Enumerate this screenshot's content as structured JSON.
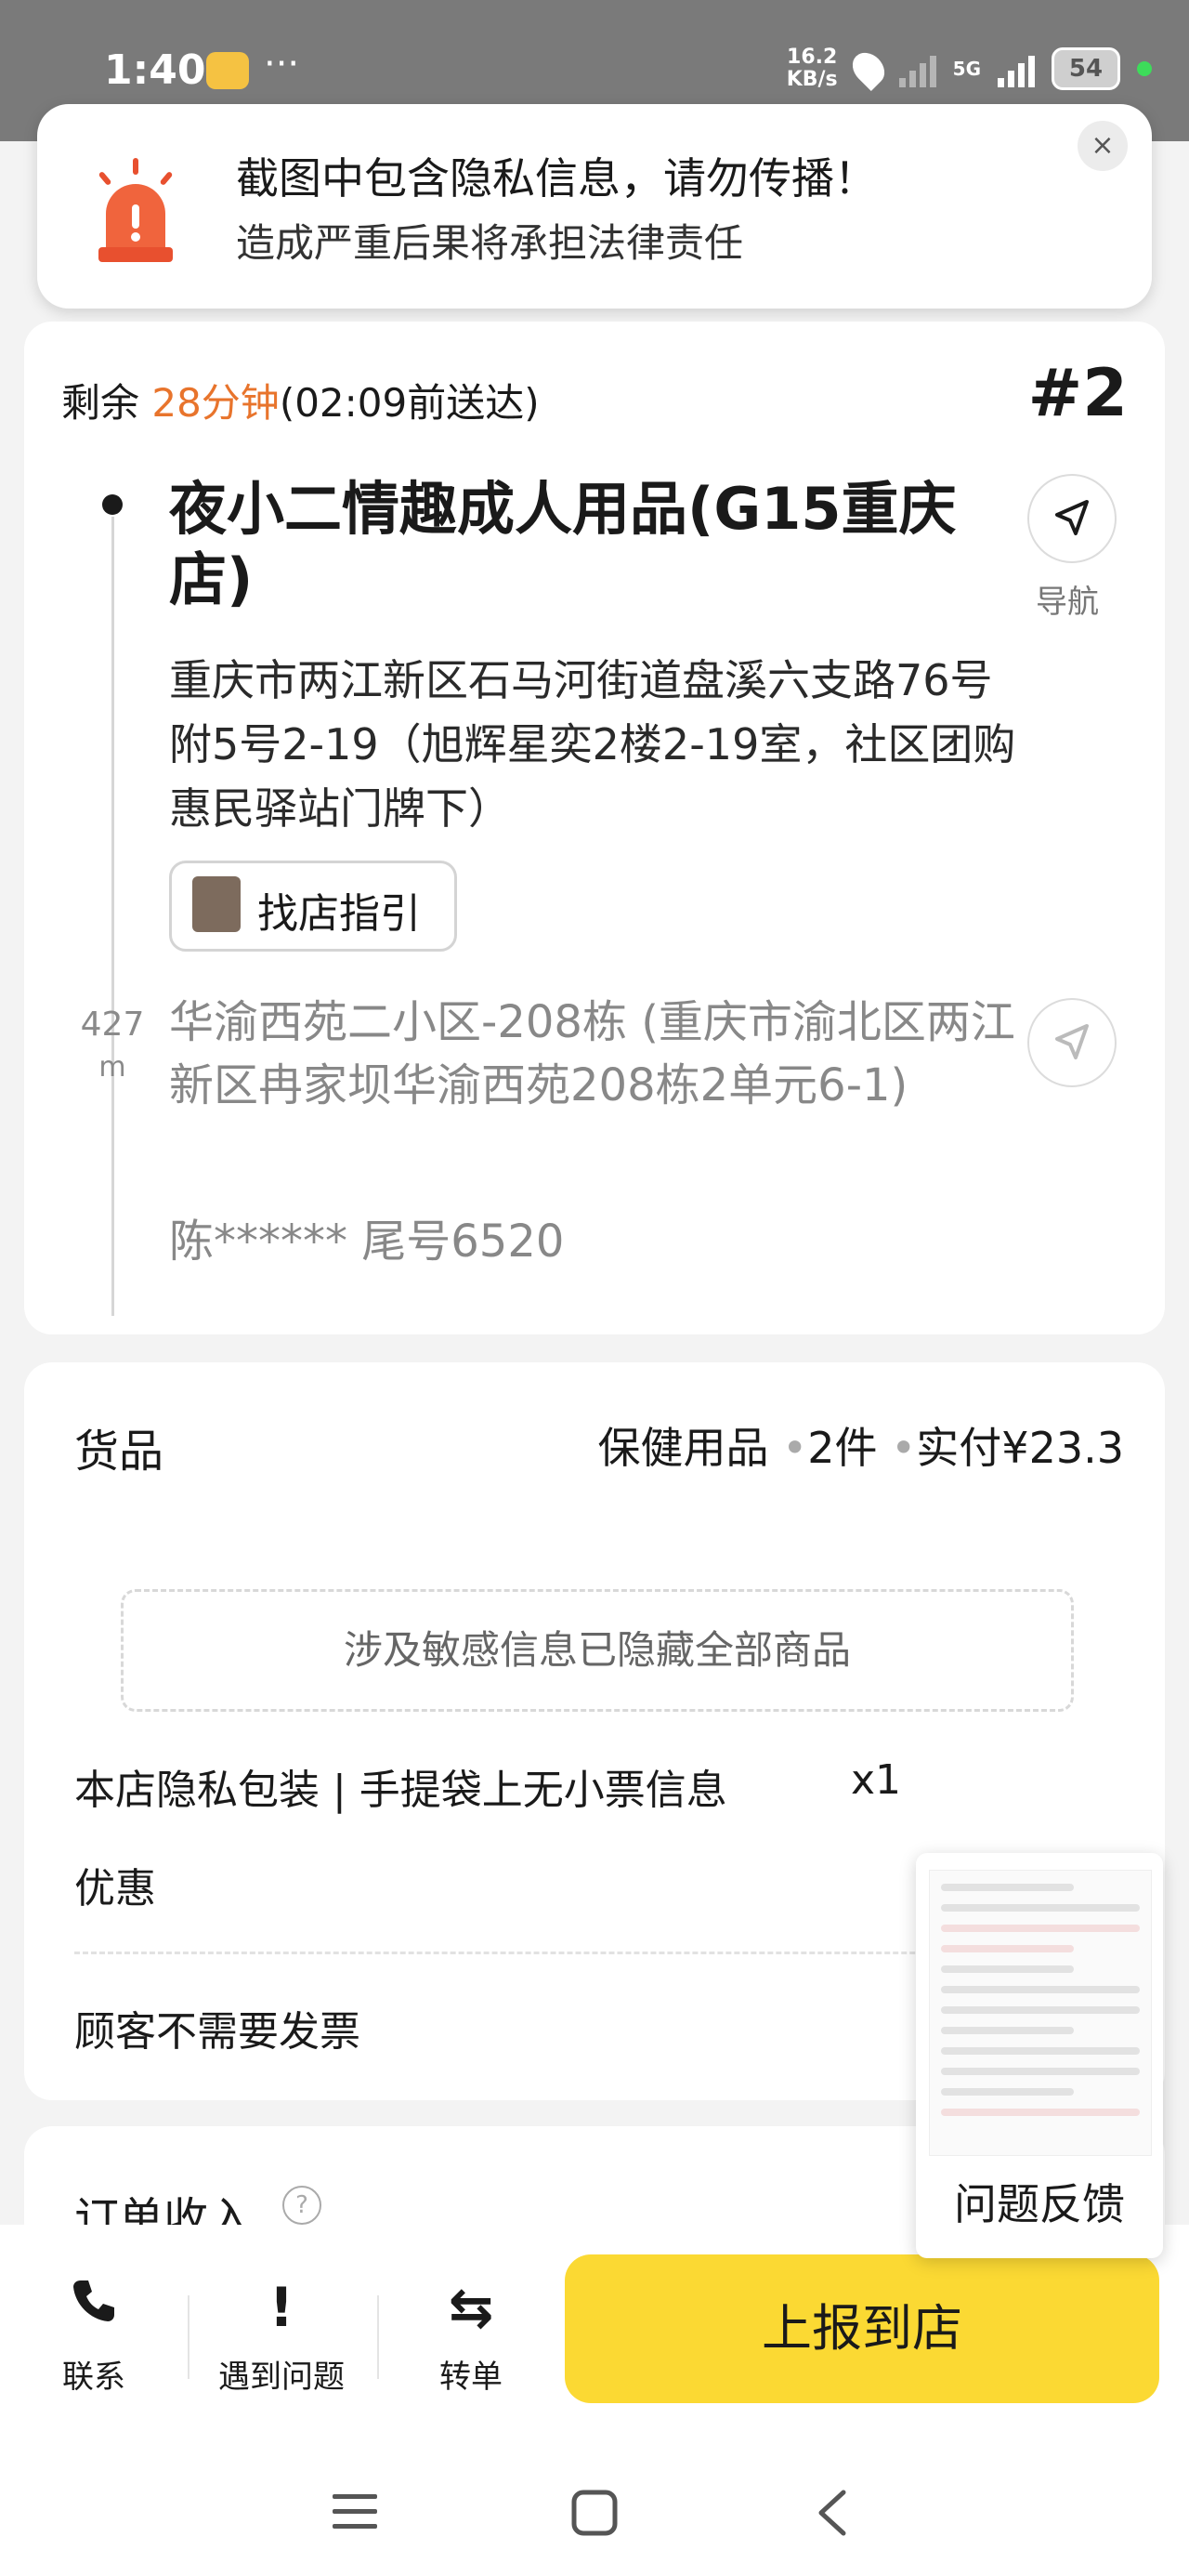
{
  "status_bar": {
    "time": "1:40",
    "dots": "···",
    "net_speed_value": "16.2",
    "net_speed_unit": "KB/s",
    "network": "5G",
    "battery": "54"
  },
  "privacy_notice": {
    "title": "截图中包含隐私信息，请勿传播！",
    "subtitle": "造成严重后果将承担法律责任",
    "close_icon": "×"
  },
  "delivery": {
    "remaining_prefix": "剩余 ",
    "remaining_time": "28分钟",
    "deadline": "(02:09前送达)",
    "order_number": "#2",
    "shop_name": "夜小二情趣成人用品(G15重庆店)",
    "shop_address": "重庆市两江新区石马河街道盘溪六支路76号附5号2-19（旭辉星奕2楼2-19室，社区团购惠民驿站门牌下）",
    "nav_label": "导航",
    "guide_button": "找店指引",
    "distance_value": "427",
    "distance_unit": "m",
    "customer_address": "华渝西苑二小区-208栋 (重庆市渝北区两江新区冉家坝华渝西苑208栋2单元6-1)",
    "customer_name": "陈****** 尾号6520"
  },
  "goods": {
    "title": "货品",
    "category": "保健用品",
    "count": "2件",
    "paid": "实付¥23.3",
    "hidden_notice": "涉及敏感信息已隐藏全部商品",
    "package_item": "本店隐私包装 | 手提袋上无小票信息",
    "package_qty": "x1",
    "discount_label": "优惠",
    "invoice_label": "顾客不需要发票"
  },
  "income": {
    "title": "订单收入",
    "help_icon": "?"
  },
  "bottom_bar": {
    "contact": "联系",
    "problem": "遇到问题",
    "transfer": "转单",
    "problem_icon": "!",
    "transfer_icon": "⇆",
    "report_button": "上报到店"
  },
  "feedback_widget": {
    "label": "问题反馈"
  },
  "icons": {
    "siren": "siren-icon",
    "navigate": "navigate-arrow-icon",
    "phone": "phone-icon"
  },
  "colors": {
    "accent_orange": "#e8742c",
    "report_yellow": "#fbd933",
    "siren_red": "#e8502f"
  }
}
